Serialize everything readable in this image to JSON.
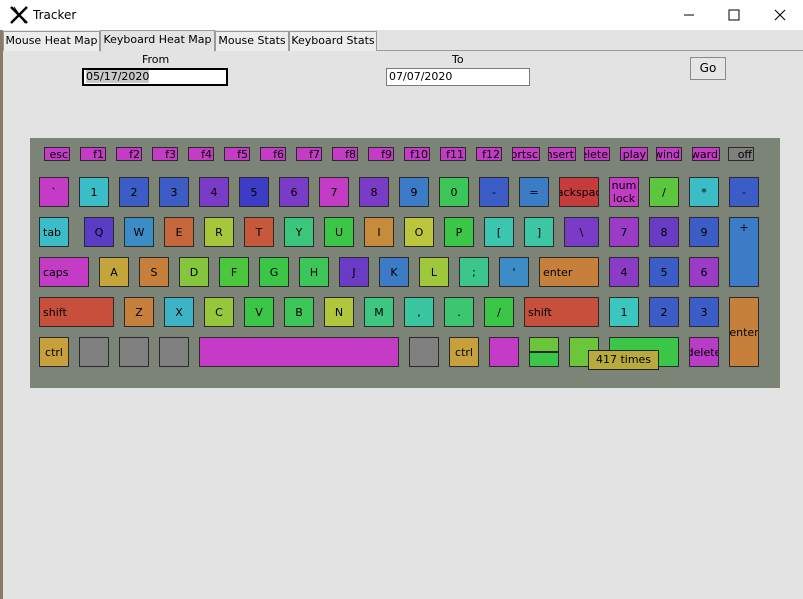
{
  "window": {
    "title": "Tracker",
    "minimize_label": "—",
    "maximize_label": "☐",
    "close_label": "✕"
  },
  "tabs": [
    "Mouse Heat Map",
    "Keyboard Heat Map",
    "Mouse Stats",
    "Keyboard Stats"
  ],
  "active_tab": "Keyboard Heat Map",
  "filter": {
    "from_label": "From",
    "from_value": "05/17/2020",
    "to_label": "To",
    "to_value": "07/07/2020",
    "go_label": "Go"
  },
  "tooltip": "417 times",
  "keys": [
    {
      "label": "esc",
      "color": "#c43cc6"
    },
    {
      "label": "f1",
      "color": "#c43cc6"
    },
    {
      "label": "f2",
      "color": "#c43cc6"
    },
    {
      "label": "f3",
      "color": "#c43cc6"
    },
    {
      "label": "f4",
      "color": "#c43cc6"
    },
    {
      "label": "f5",
      "color": "#c43cc6"
    },
    {
      "label": "f6",
      "color": "#c43cc6"
    },
    {
      "label": "f7",
      "color": "#c43cc6"
    },
    {
      "label": "f8",
      "color": "#c43cc6"
    },
    {
      "label": "f9",
      "color": "#c43cc6"
    },
    {
      "label": "f10",
      "color": "#c43cc6"
    },
    {
      "label": "f11",
      "color": "#c43cc6"
    },
    {
      "label": "f12",
      "color": "#c43cc6"
    },
    {
      "label": "prtsc",
      "color": "#c43cc6"
    },
    {
      "label": "insert",
      "color": "#c43cc6"
    },
    {
      "label": "delete",
      "color": "#c43cc6"
    },
    {
      "label": "play",
      "color": "#c43cc6"
    },
    {
      "label": "rewind",
      "color": "#c43cc6"
    },
    {
      "label": "fastforward",
      "color": "#c43cc6"
    },
    {
      "label": "off",
      "color": "#808080"
    },
    {
      "label": "`",
      "color": "#c43cc6"
    },
    {
      "label": "1",
      "color": "#3cbcc6"
    },
    {
      "label": "2",
      "color": "#3c5cc6"
    },
    {
      "label": "3",
      "color": "#3c5cc6"
    },
    {
      "label": "4",
      "color": "#7a3cc6"
    },
    {
      "label": "5",
      "color": "#3c3cc6"
    },
    {
      "label": "6",
      "color": "#7a3cc6"
    },
    {
      "label": "7",
      "color": "#c43cc6"
    },
    {
      "label": "8",
      "color": "#7a3cc6"
    },
    {
      "label": "9",
      "color": "#3c7cc6"
    },
    {
      "label": "0",
      "color": "#3cc65a"
    },
    {
      "label": "-",
      "color": "#3c5cc6"
    },
    {
      "label": "=",
      "color": "#3c7cc6"
    },
    {
      "label": "backspace",
      "color": "#c63c3c"
    },
    {
      "label": "num lock",
      "color": "#c43cc6"
    },
    {
      "label": "/",
      "color": "#5cc63c"
    },
    {
      "label": "*",
      "color": "#3cbcc6"
    },
    {
      "label": "-",
      "color": "#3c5cc6"
    },
    {
      "label": "tab",
      "color": "#3cbcc6"
    },
    {
      "label": "Q",
      "color": "#5a3cc6"
    },
    {
      "label": "W",
      "color": "#3c8cc6"
    },
    {
      "label": "E",
      "color": "#c6663c"
    },
    {
      "label": "R",
      "color": "#a6c63c"
    },
    {
      "label": "T",
      "color": "#c6583c"
    },
    {
      "label": "Y",
      "color": "#3cc67c"
    },
    {
      "label": "U",
      "color": "#3cc648"
    },
    {
      "label": "I",
      "color": "#c68c3c"
    },
    {
      "label": "O",
      "color": "#bcc63c"
    },
    {
      "label": "P",
      "color": "#3cc648"
    },
    {
      "label": "[",
      "color": "#3cc6b0"
    },
    {
      "label": "]",
      "color": "#3cc6a4"
    },
    {
      "label": "\\",
      "color": "#7a3cc6"
    },
    {
      "label": "7",
      "color": "#9a3cc6"
    },
    {
      "label": "8",
      "color": "#6a3cc6"
    },
    {
      "label": "9",
      "color": "#3c5cc6"
    },
    {
      "label": "+",
      "color": "#3c7cc6"
    },
    {
      "label": "caps",
      "color": "#c43cc6"
    },
    {
      "label": "A",
      "color": "#c6a43c"
    },
    {
      "label": "S",
      "color": "#c6803c"
    },
    {
      "label": "D",
      "color": "#86c63c"
    },
    {
      "label": "F",
      "color": "#4cc63c"
    },
    {
      "label": "G",
      "color": "#3cc648"
    },
    {
      "label": "H",
      "color": "#3cc658"
    },
    {
      "label": "J",
      "color": "#6a3cc6"
    },
    {
      "label": "K",
      "color": "#3c7cc6"
    },
    {
      "label": "L",
      "color": "#a0c63c"
    },
    {
      "label": ";",
      "color": "#3cc68c"
    },
    {
      "label": "'",
      "color": "#3c8cc6"
    },
    {
      "label": "enter",
      "color": "#c6803c"
    },
    {
      "label": "4",
      "color": "#8a3cc6"
    },
    {
      "label": "5",
      "color": "#3c5cc6"
    },
    {
      "label": "6",
      "color": "#9a3cc6"
    },
    {
      "label": "shift",
      "color": "#c6503c"
    },
    {
      "label": "Z",
      "color": "#c6803c"
    },
    {
      "label": "X",
      "color": "#3cb4c6"
    },
    {
      "label": "C",
      "color": "#96c63c"
    },
    {
      "label": "V",
      "color": "#3cc648"
    },
    {
      "label": "B",
      "color": "#3cc658"
    },
    {
      "label": "N",
      "color": "#b0c63c"
    },
    {
      "label": "M",
      "color": "#3cc680"
    },
    {
      "label": ",",
      "color": "#3cc6a0"
    },
    {
      "label": ".",
      "color": "#3cc670"
    },
    {
      "label": "/",
      "color": "#3cc648"
    },
    {
      "label": "shift",
      "color": "#c6503c"
    },
    {
      "label": "1",
      "color": "#3cc6c0"
    },
    {
      "label": "2",
      "color": "#3c5cc6"
    },
    {
      "label": "3",
      "color": "#3c5cc6"
    },
    {
      "label": "enter",
      "color": "#c6803c"
    },
    {
      "label": "ctrl",
      "color": "#c6a03c"
    },
    {
      "label": "",
      "color": "#808080"
    },
    {
      "label": "",
      "color": "#808080"
    },
    {
      "label": "",
      "color": "#808080"
    },
    {
      "label": "",
      "color": "#c43cc6"
    },
    {
      "label": "",
      "color": "#808080"
    },
    {
      "label": "ctrl",
      "color": "#c6a03c"
    },
    {
      "label": "",
      "color": "#c43cc6"
    },
    {
      "label": "",
      "color": "#6cc63c"
    },
    {
      "label": "",
      "color": "#3cc648"
    },
    {
      "label": "",
      "color": "#6cc63c"
    },
    {
      "label": "",
      "color": "#3cc648"
    },
    {
      "label": "delete",
      "color": "#b83cc6"
    }
  ]
}
